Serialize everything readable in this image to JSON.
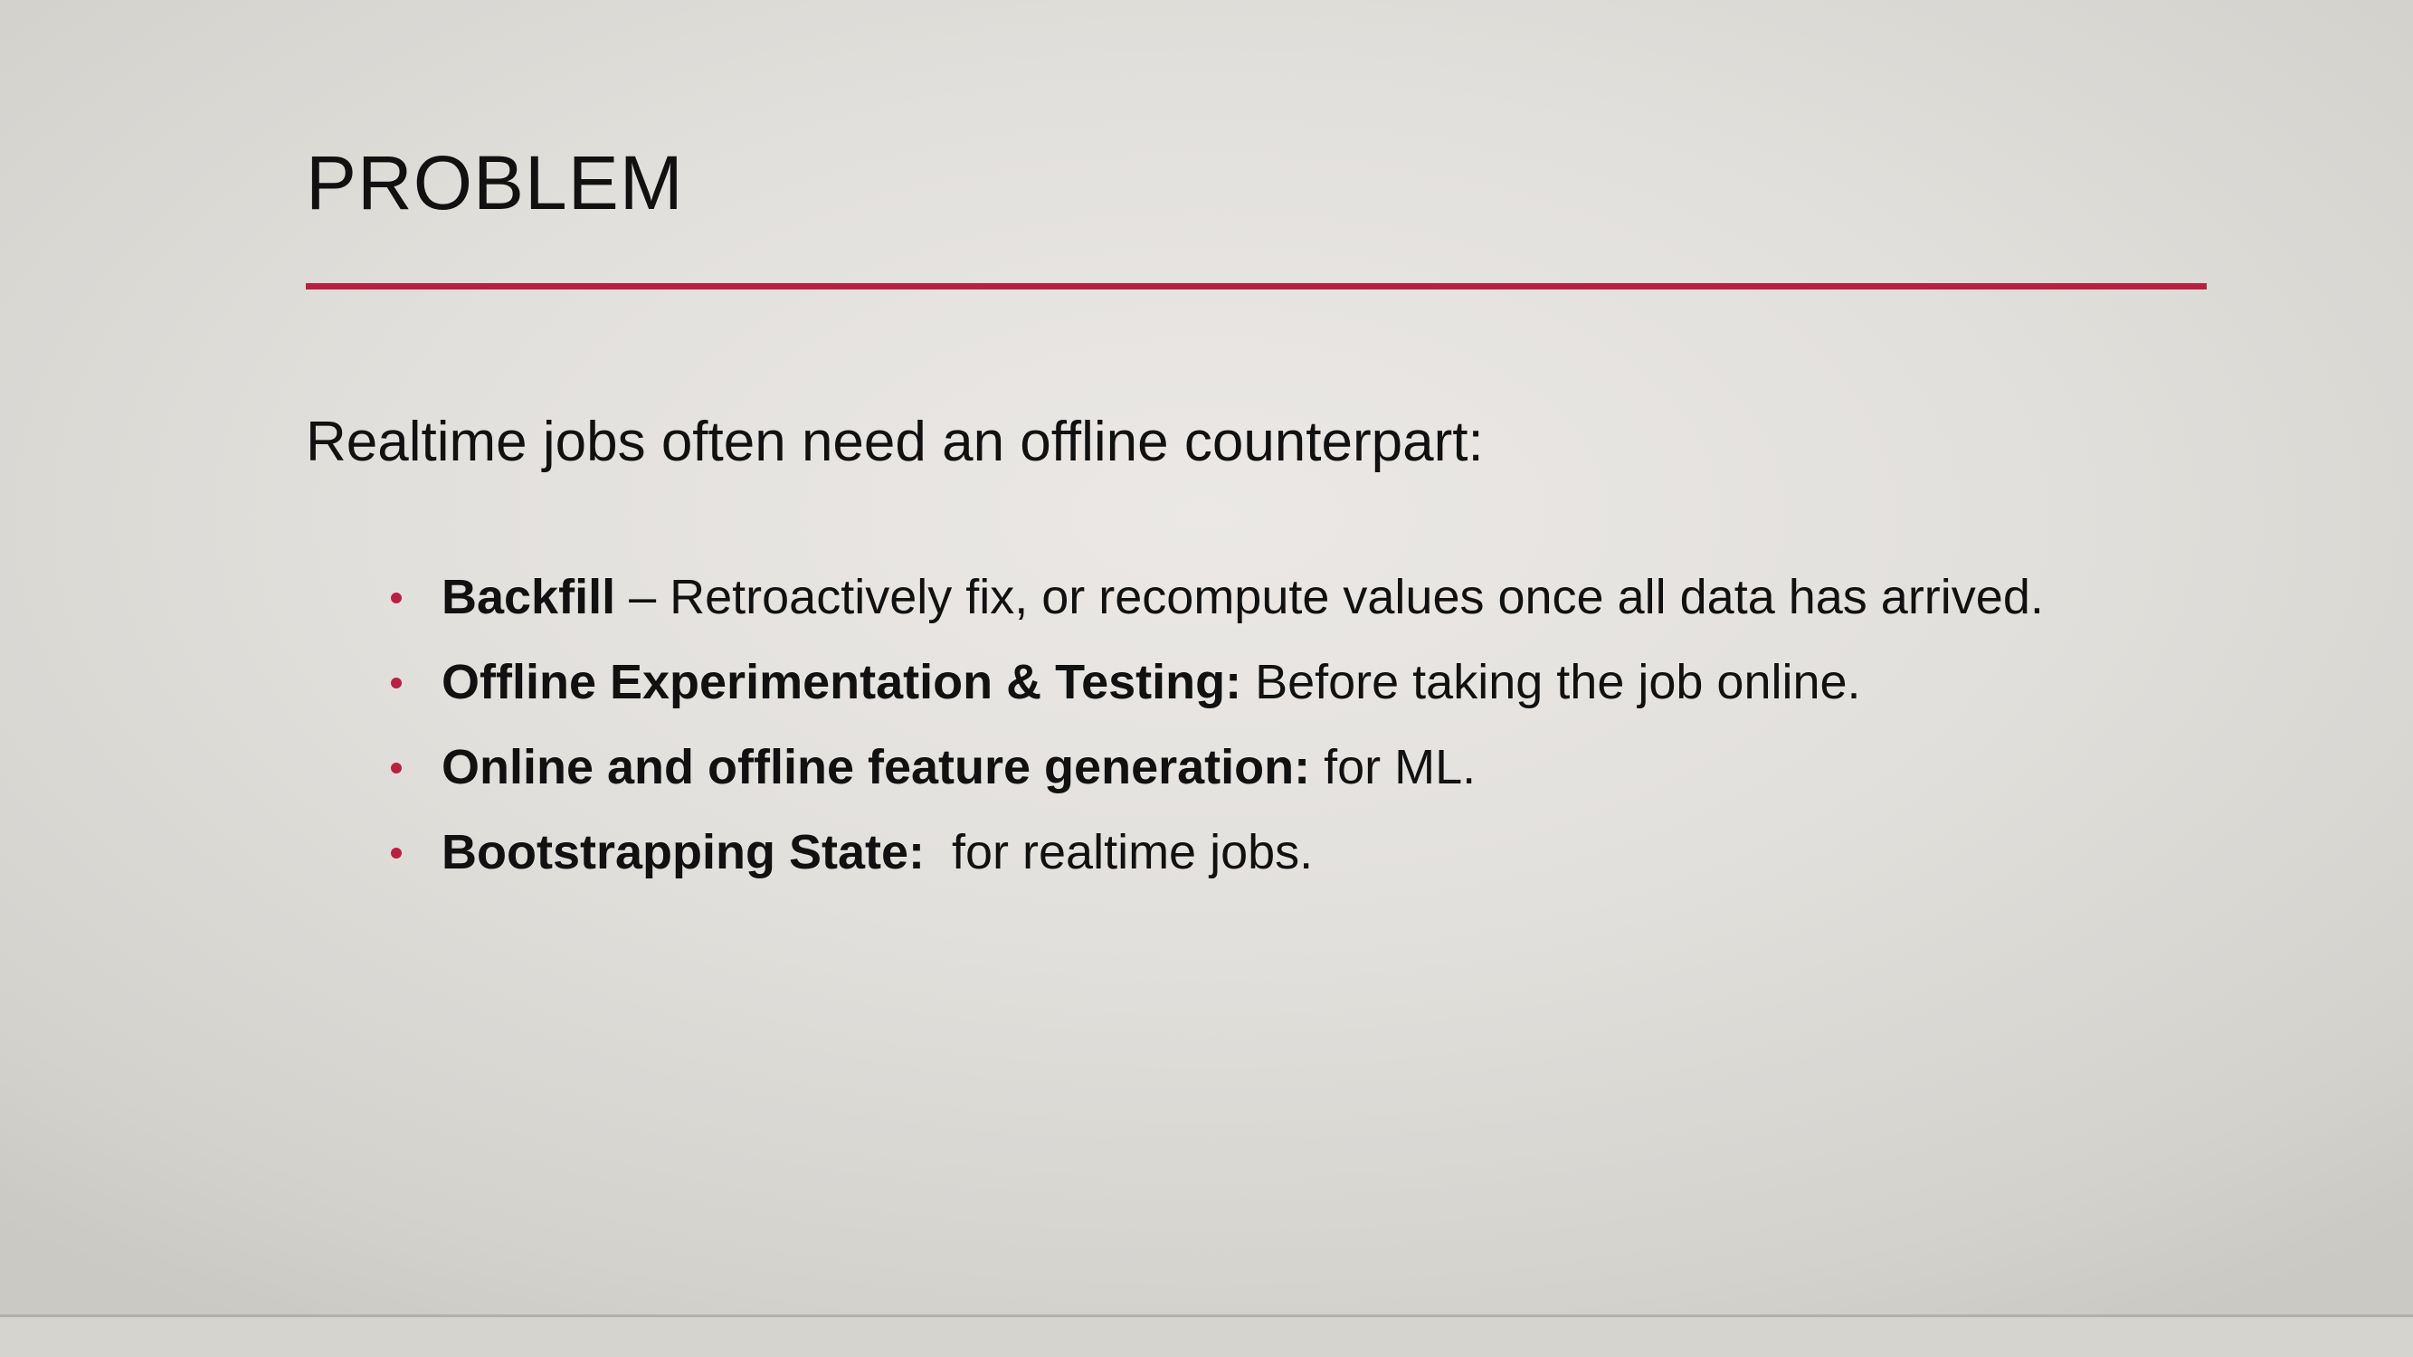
{
  "slide": {
    "title": "PROBLEM",
    "accent_color": "#b8203f",
    "intro": "Realtime jobs often need an offline counterpart:",
    "bullets": [
      {
        "term": "Backfill",
        "text": " – Retroactively fix, or recompute values once all data has arrived."
      },
      {
        "term": "Offline Experimentation & Testing:",
        "text": " Before taking the job online."
      },
      {
        "term": "Online and offline feature generation:",
        "text": " for ML."
      },
      {
        "term": "Bootstrapping State:",
        "text": "  for realtime jobs."
      }
    ]
  }
}
